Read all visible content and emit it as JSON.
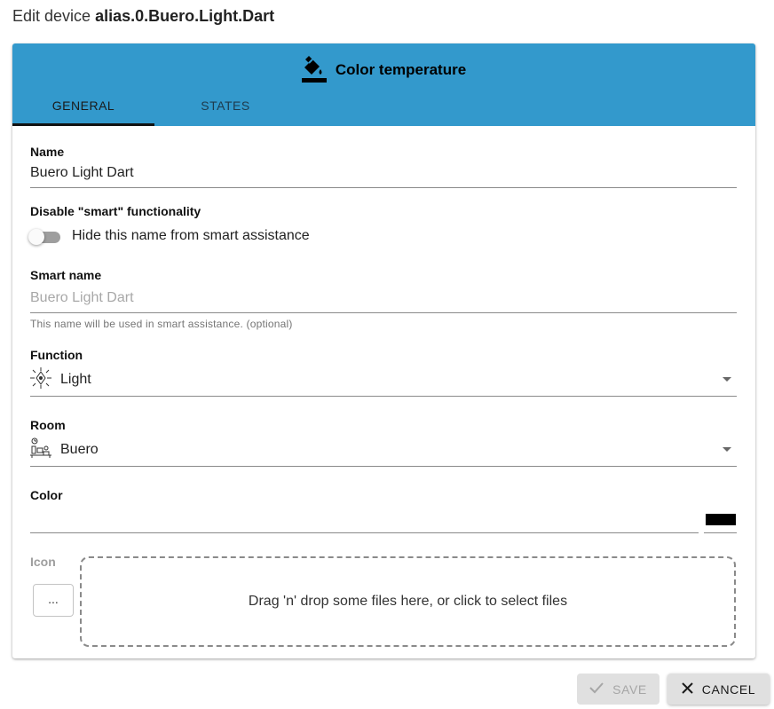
{
  "dialog": {
    "title_prefix": "Edit device",
    "device_id": "alias.0.Buero.Light.Dart"
  },
  "header": {
    "icon": "paint-bucket-icon",
    "title": "Color temperature",
    "tabs": [
      {
        "label": "GENERAL",
        "active": true
      },
      {
        "label": "STATES",
        "active": false
      }
    ],
    "color": "#3399cc"
  },
  "form": {
    "name": {
      "label": "Name",
      "value": "Buero Light Dart"
    },
    "disable_smart": {
      "label": "Disable \"smart\" functionality",
      "switch_label": "Hide this name from smart assistance",
      "checked": false
    },
    "smart_name": {
      "label": "Smart name",
      "placeholder": "Buero Light Dart",
      "helper": "This name will be used in smart assistance. (optional)"
    },
    "function": {
      "label": "Function",
      "value": "Light",
      "icon": "light-sparkle-icon"
    },
    "room": {
      "label": "Room",
      "value": "Buero",
      "icon": "office-desk-icon"
    },
    "color": {
      "label": "Color",
      "value": "#000000"
    },
    "icon": {
      "label": "Icon",
      "browse_label": "...",
      "dropzone_text": "Drag 'n' drop some files here, or click to select files"
    }
  },
  "actions": {
    "save_label": "SAVE",
    "save_enabled": false,
    "cancel_label": "CANCEL"
  }
}
